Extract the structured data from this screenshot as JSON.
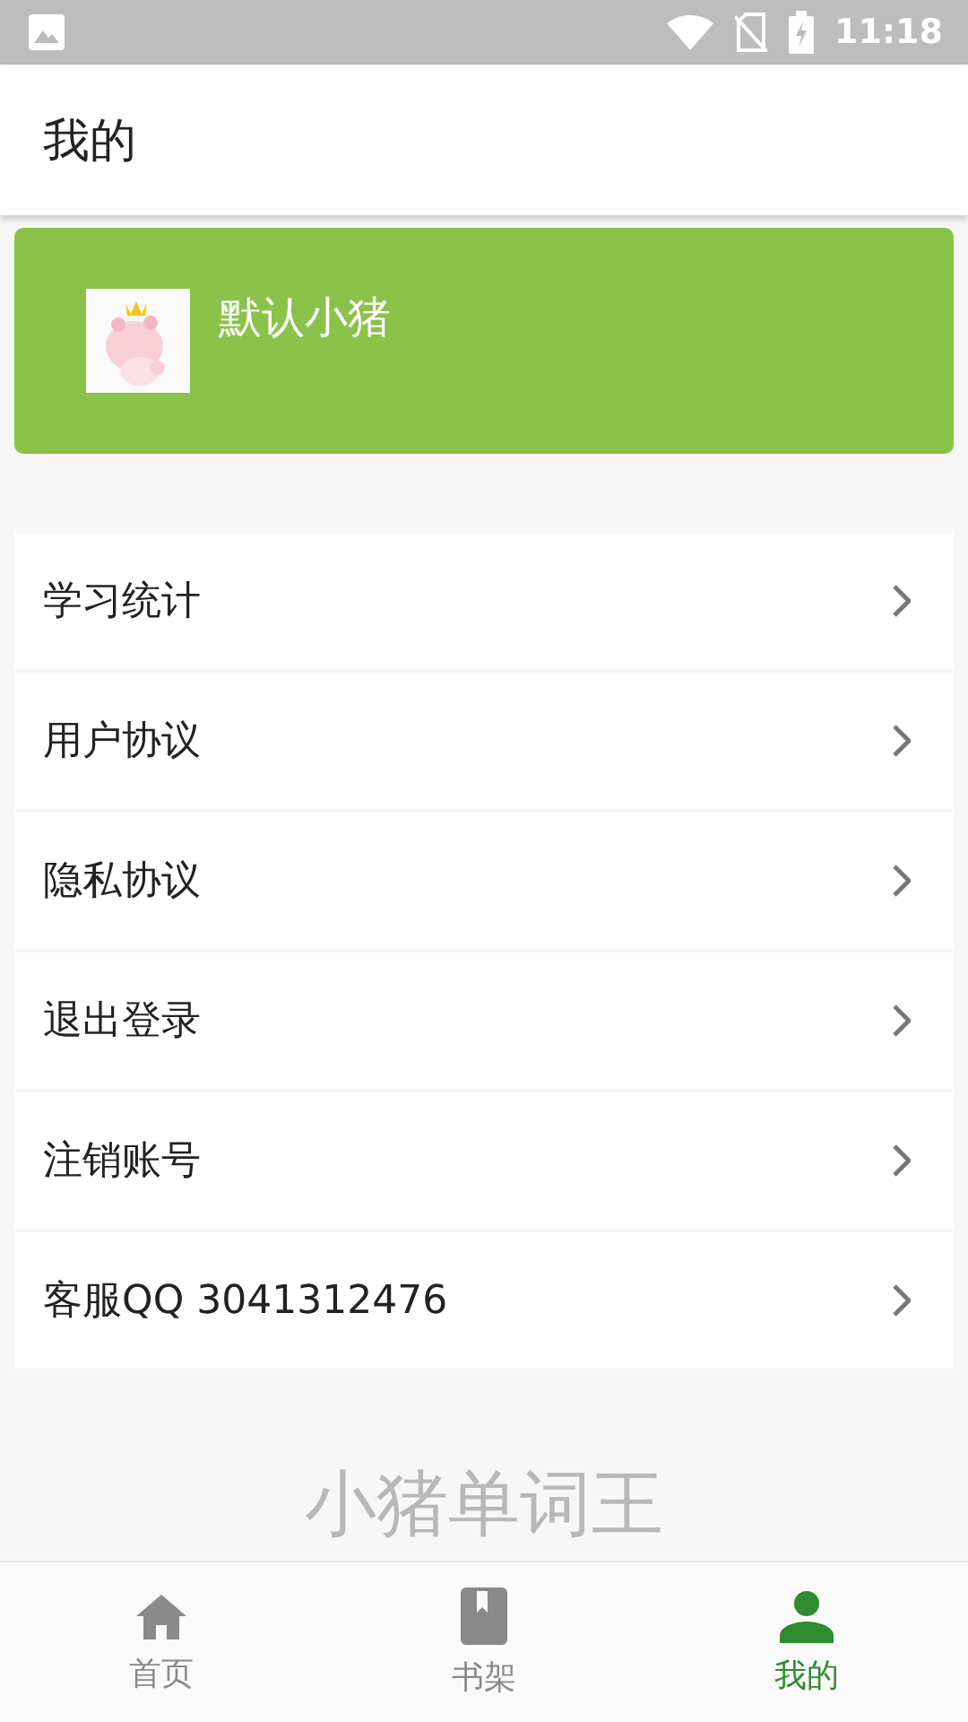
{
  "status_bar": {
    "time": "11:18"
  },
  "header": {
    "title": "我的"
  },
  "profile": {
    "name": "默认小猪"
  },
  "menu": [
    {
      "label": "学习统计"
    },
    {
      "label": "用户协议"
    },
    {
      "label": "隐私协议"
    },
    {
      "label": "退出登录"
    },
    {
      "label": "注销账号"
    },
    {
      "label": "客服QQ 3041312476"
    }
  ],
  "footer_text": "小猪单词王",
  "bottom_nav": [
    {
      "label": "首页",
      "kind": "home",
      "selected": false
    },
    {
      "label": "书架",
      "kind": "book",
      "selected": false
    },
    {
      "label": "我的",
      "kind": "person",
      "selected": true
    }
  ]
}
